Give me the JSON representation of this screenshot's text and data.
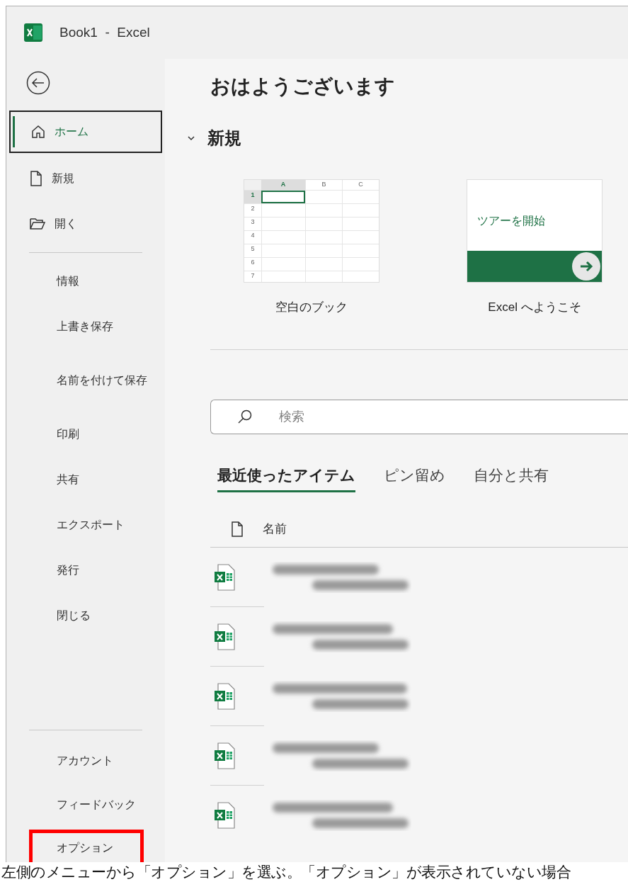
{
  "window": {
    "title": "Book1  -  Excel"
  },
  "sidebar": {
    "top_items": [
      {
        "label": "ホーム",
        "kind": "home",
        "selected": true
      },
      {
        "label": "新規",
        "kind": "new",
        "selected": false
      },
      {
        "label": "開く",
        "kind": "open",
        "selected": false
      }
    ],
    "middle_items": [
      {
        "label": "情報"
      },
      {
        "label": "上書き保存"
      },
      {
        "label": "名前を付けて保存"
      },
      {
        "label": "印刷"
      },
      {
        "label": "共有"
      },
      {
        "label": "エクスポート"
      },
      {
        "label": "発行"
      },
      {
        "label": "閉じる"
      }
    ],
    "bottom_items": [
      {
        "label": "アカウント",
        "highlighted": false
      },
      {
        "label": "フィードバック",
        "highlighted": false
      },
      {
        "label": "オプション",
        "highlighted": true
      }
    ]
  },
  "main": {
    "greeting": "おはようございます",
    "section": {
      "title": "新規",
      "expanded": true
    },
    "templates": [
      {
        "kind": "blank",
        "label": "空白のブック",
        "columns": [
          "A",
          "B",
          "C"
        ],
        "rows": [
          "1",
          "2",
          "3",
          "4",
          "5",
          "6",
          "7"
        ]
      },
      {
        "kind": "tour",
        "label": "Excel へようこそ",
        "tour_text": "ツアーを開始"
      }
    ],
    "search": {
      "placeholder": "検索"
    },
    "tabs": [
      {
        "label": "最近使ったアイテム",
        "selected": true
      },
      {
        "label": "ピン留め",
        "selected": false
      },
      {
        "label": "自分と共有",
        "selected": false
      }
    ],
    "file_list": {
      "column": "名前",
      "rows": [
        {
          "kind": "excel"
        },
        {
          "kind": "excel"
        },
        {
          "kind": "excel"
        },
        {
          "kind": "excel"
        },
        {
          "kind": "excel"
        }
      ]
    }
  },
  "caption": "左側のメニューから「オプション」を選ぶ。「オプション」が表示されていない場合"
}
